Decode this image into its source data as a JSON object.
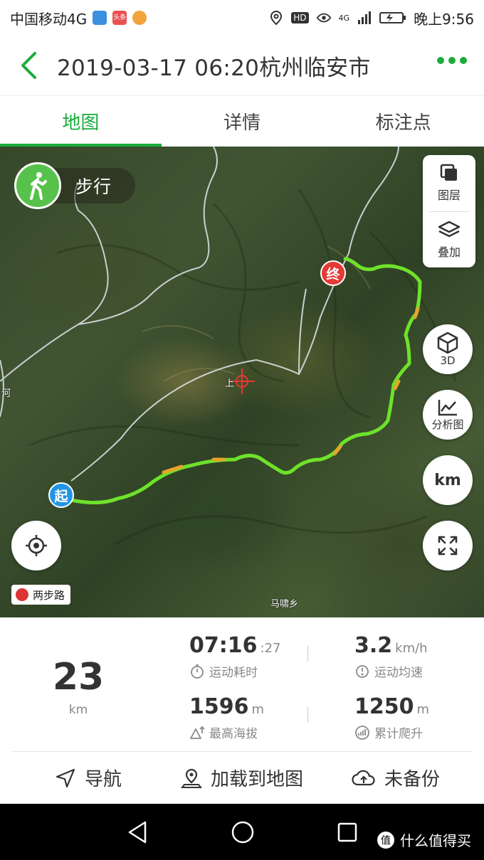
{
  "status_bar": {
    "carrier": "中国移动4G",
    "news_badge": "头条",
    "network": "4G",
    "time": "晚上9:56",
    "hd_label": "HD"
  },
  "header": {
    "title": "2019-03-17 06:20杭州临安市"
  },
  "tabs": [
    {
      "label": "地图",
      "active": true
    },
    {
      "label": "详情",
      "active": false
    },
    {
      "label": "标注点",
      "active": false
    }
  ],
  "map": {
    "mode_label": "步行",
    "layer_label": "图层",
    "overlay_label": "叠加",
    "btn_3d": "3D",
    "btn_analysis": "分析图",
    "btn_km": "km",
    "start_marker": "起",
    "end_marker": "终",
    "place_labels": [
      "马啸乡",
      "上",
      "河"
    ],
    "scale_chip": "两步路",
    "route_color": "#66dd22",
    "accent_color": "#1aad3c"
  },
  "stats": {
    "distance": {
      "value": "23",
      "unit": "km"
    },
    "duration": {
      "value": "07:16",
      "seconds": ":27",
      "label": "运动耗时"
    },
    "avg_speed": {
      "value": "3.2",
      "unit": "km/h",
      "label": "运动均速"
    },
    "max_altitude": {
      "value": "1596",
      "unit": "m",
      "label": "最高海拔"
    },
    "total_climb": {
      "value": "1250",
      "unit": "m",
      "label": "累计爬升"
    }
  },
  "actions": [
    {
      "label": "导航",
      "icon": "navigation-arrow-icon"
    },
    {
      "label": "加载到地图",
      "icon": "map-pin-icon"
    },
    {
      "label": "未备份",
      "icon": "cloud-upload-icon"
    }
  ],
  "watermark": {
    "text": "什么值得买",
    "logo": "值"
  }
}
